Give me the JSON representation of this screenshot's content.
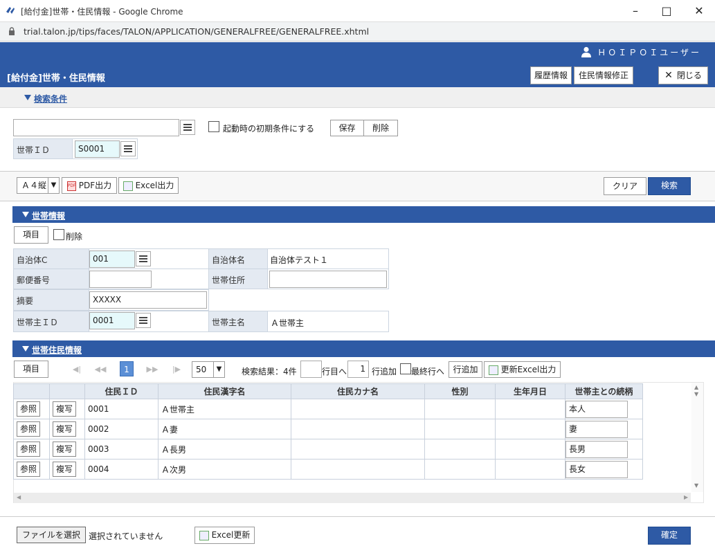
{
  "window": {
    "title": "[給付金]世帯・住民情報 - Google Chrome",
    "url": "trial.talon.jp/tips/faces/TALON/APPLICATION/GENERALFREE/GENERALFREE.xhtml"
  },
  "header": {
    "user": "ＨＯＩＰＯＩユーザー",
    "page_title": "[給付金]世帯・住民情報",
    "history_btn": "履歴情報",
    "edit_btn": "住民情報修正",
    "close_btn": "閉じる"
  },
  "search": {
    "section_label": "検索条件",
    "condition_value": "",
    "default_label": "起動時の初期条件にする",
    "save_btn": "保存",
    "delete_btn": "削除",
    "household_id_label": "世帯ＩＤ",
    "household_id_value": "S0001"
  },
  "toolbar": {
    "paper_select": "Ａ４縦",
    "pdf_btn": "PDF出力",
    "excel_btn": "Excel出力",
    "clear_btn": "クリア",
    "search_btn": "検索"
  },
  "household": {
    "section_label": "世帯情報",
    "items_btn": "項目",
    "delete_label": "削除",
    "municipality_code_label": "自治体C",
    "municipality_code_value": "001",
    "municipality_name_label": "自治体名",
    "municipality_name_value": "自治体テスト１",
    "postal_label": "郵便番号",
    "postal_value": "",
    "address_label": "世帯住所",
    "address_value": "",
    "summary_label": "摘要",
    "summary_value": "XXXXX",
    "head_id_label": "世帯主ＩＤ",
    "head_id_value": "0001",
    "head_name_label": "世帯主名",
    "head_name_value": "Ａ世帯主"
  },
  "residents": {
    "section_label": "世帯住民情報",
    "items_btn": "項目",
    "page": "1",
    "page_size": "50",
    "result_text": "検索結果：4件",
    "goto_value": "",
    "goto_label": "行目へ",
    "add_count": "1",
    "add_label": "行追加",
    "last_row_label": "最終行へ",
    "add_row_btn": "行追加",
    "update_excel_btn": "更新Excel出力",
    "columns": [
      "",
      "",
      "住民ＩＤ",
      "住民漢字名",
      "住民カナ名",
      "性別",
      "生年月日",
      "世帯主との続柄"
    ],
    "ref_btn": "参照",
    "copy_btn": "複写",
    "rows": [
      {
        "id": "0001",
        "kanji": "Ａ世帯主",
        "kana": "",
        "sex": "",
        "birth": "",
        "relation": "本人"
      },
      {
        "id": "0002",
        "kanji": "Ａ妻",
        "kana": "",
        "sex": "",
        "birth": "",
        "relation": "妻"
      },
      {
        "id": "0003",
        "kanji": "Ａ長男",
        "kana": "",
        "sex": "",
        "birth": "",
        "relation": "長男"
      },
      {
        "id": "0004",
        "kanji": "Ａ次男",
        "kana": "",
        "sex": "",
        "birth": "",
        "relation": "長女"
      }
    ]
  },
  "footer": {
    "file_btn": "ファイルを選択",
    "file_status": "選択されていません",
    "excel_update_btn": "Excel更新",
    "confirm_btn": "確定"
  }
}
